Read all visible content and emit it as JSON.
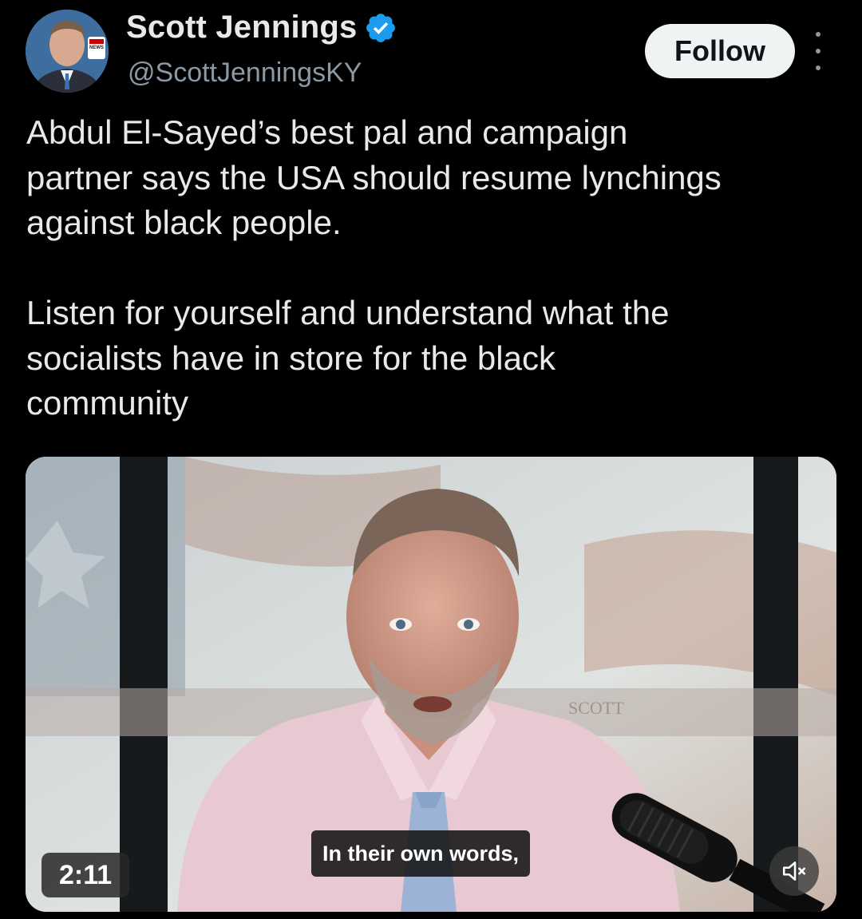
{
  "author": {
    "display_name": "Scott Jennings",
    "handle": "@ScottJenningsKY",
    "verified_color": "#1d9bf0",
    "avatar_badge": "CNN NEWS CENTRAL"
  },
  "actions": {
    "follow_label": "Follow",
    "more_icon": "more-vertical-icon"
  },
  "tweet": {
    "text": "Abdul El-Sayed’s best pal and campaign\npartner says the USA should resume lynchings\nagainst black people.\n\nListen for yourself and understand what the\nsocialists have in store for the black\ncommunity"
  },
  "media": {
    "duration": "2:11",
    "caption": "In their own words,",
    "mute_icon": "speaker-muted-icon"
  },
  "colors": {
    "background": "#000000",
    "text_primary": "#e7e9ea",
    "text_secondary": "#8b98a5",
    "follow_bg": "#eff3f4"
  }
}
